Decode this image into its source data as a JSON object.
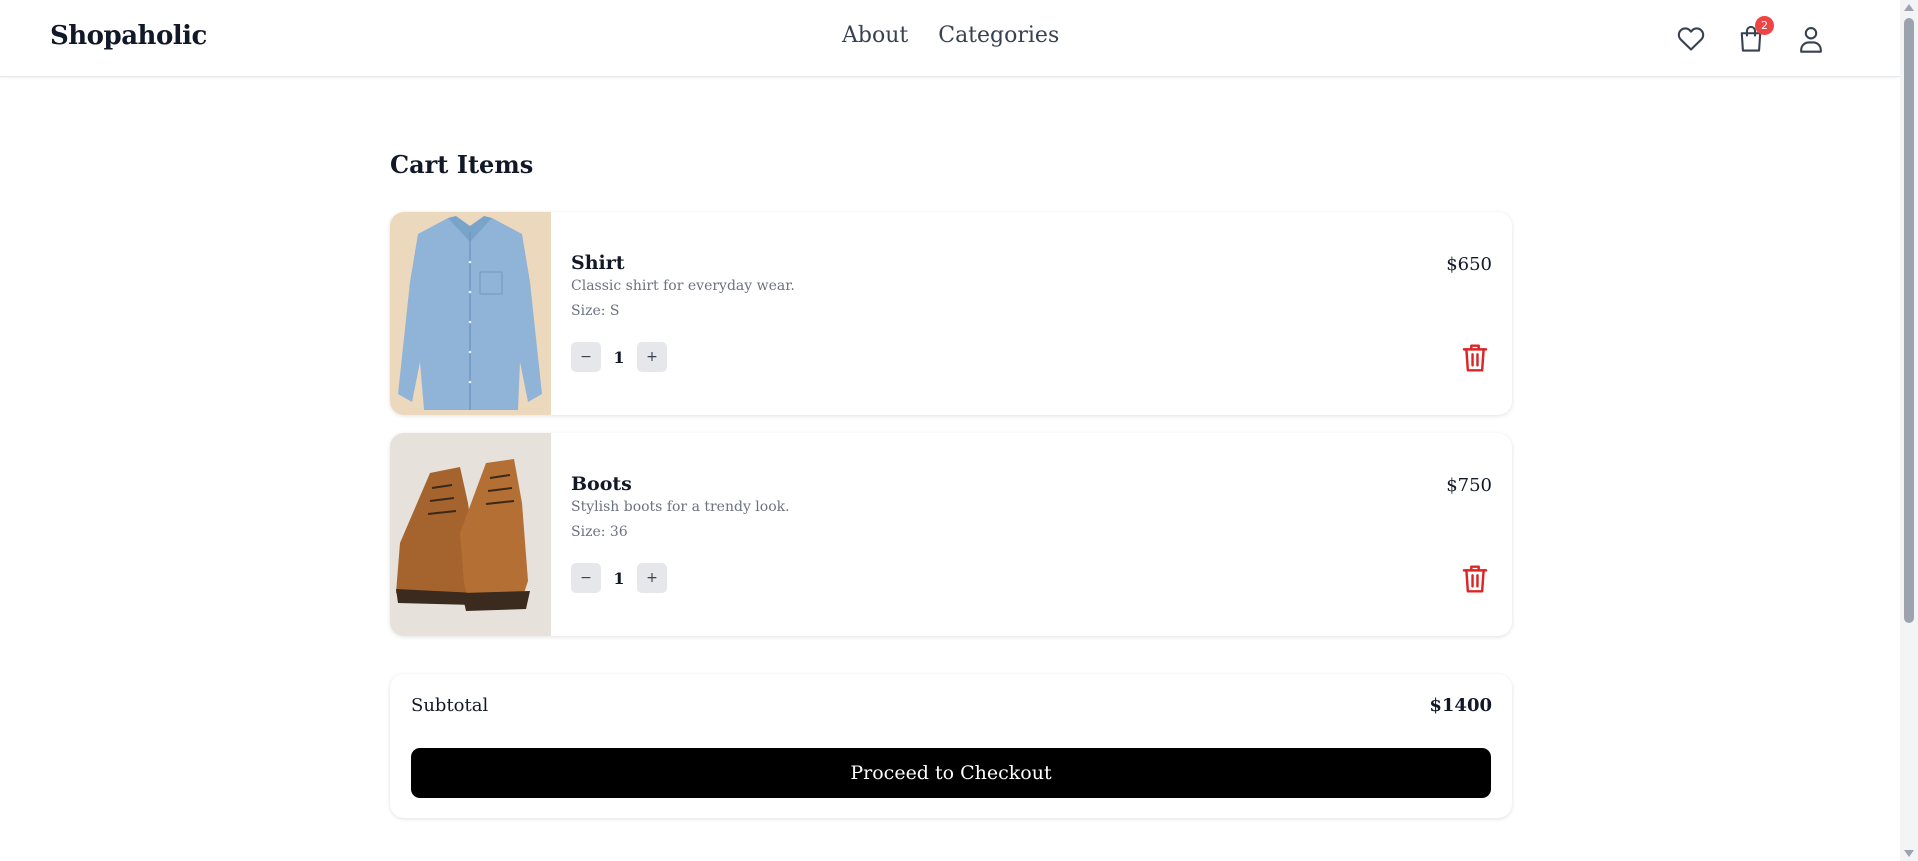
{
  "header": {
    "logo": "Shopaholic",
    "nav": [
      {
        "label": "About"
      },
      {
        "label": "Categories"
      }
    ],
    "cart_count": "2",
    "icons": [
      "heart-icon",
      "shopping-bag-icon",
      "user-icon"
    ]
  },
  "main": {
    "title": "Cart Items",
    "items": [
      {
        "name": "Shirt",
        "description": "Classic shirt for everyday wear.",
        "size": "Size: S",
        "price": "$650",
        "quantity": "1",
        "minus_label": "−",
        "plus_label": "+"
      },
      {
        "name": "Boots",
        "description": "Stylish boots for a trendy look.",
        "size": "Size: 36",
        "price": "$750",
        "quantity": "1",
        "minus_label": "−",
        "plus_label": "+"
      }
    ],
    "summary": {
      "subtotal_label": "Subtotal",
      "subtotal_value": "$1400",
      "checkout_label": "Proceed to Checkout"
    }
  },
  "colors": {
    "accent": "#000000",
    "badge": "#ef4444",
    "delete": "#dc2626",
    "muted_text": "#6b7280"
  }
}
